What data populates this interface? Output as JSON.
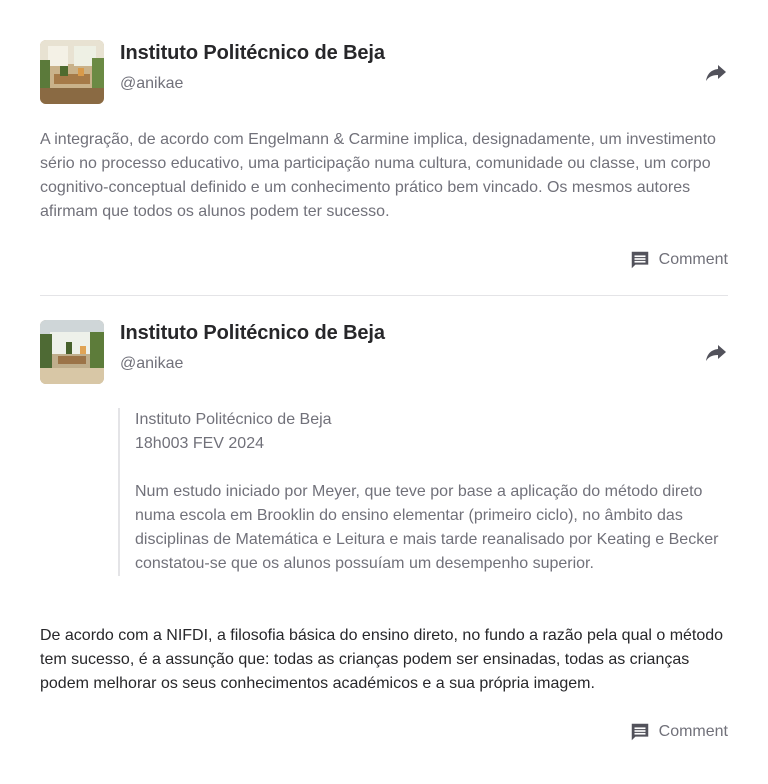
{
  "posts": [
    {
      "author": "Instituto Politécnico de Beja",
      "handle": "@anikae",
      "text": "A integração, de acordo com Engelmann & Carmine implica, designadamente, um investimento sério no processo educativo, uma participação numa cultura, comunidade ou classe, um corpo cognitivo-conceptual definido e um conhecimento prático bem vincado. Os mesmos autores afirmam que todos os alunos podem ter sucesso.",
      "comment_label": "Comment",
      "share_icon": "share-arrow-icon",
      "comment_icon": "comment-icon"
    },
    {
      "author": "Instituto Politécnico de Beja",
      "handle": "@anikae",
      "quote": {
        "source": "Instituto Politécnico de Beja",
        "date": "18h003 FEV 2024",
        "text": "Num estudo iniciado por Meyer, que teve por base a aplicação do método direto numa escola em Brooklin do ensino elementar (primeiro ciclo), no âmbito das disciplinas de Matemática e Leitura e mais tarde reanalisado por Keating e Becker constatou-se que os alunos possuíam um desempenho superior."
      },
      "text": "De acordo com a NIFDI, a filosofia básica do ensino direto, no fundo a razão pela qual o método tem sucesso, é a assunção que: todas as crianças podem ser ensinadas, todas as crianças podem melhorar os seus conhecimentos académicos e a sua própria imagem.",
      "comment_label": "Comment",
      "share_icon": "share-arrow-icon",
      "comment_icon": "comment-icon"
    }
  ],
  "colors": {
    "heading": "#27272a",
    "muted": "#71717a",
    "icon": "#52525b",
    "divider": "#e4e4e7"
  }
}
